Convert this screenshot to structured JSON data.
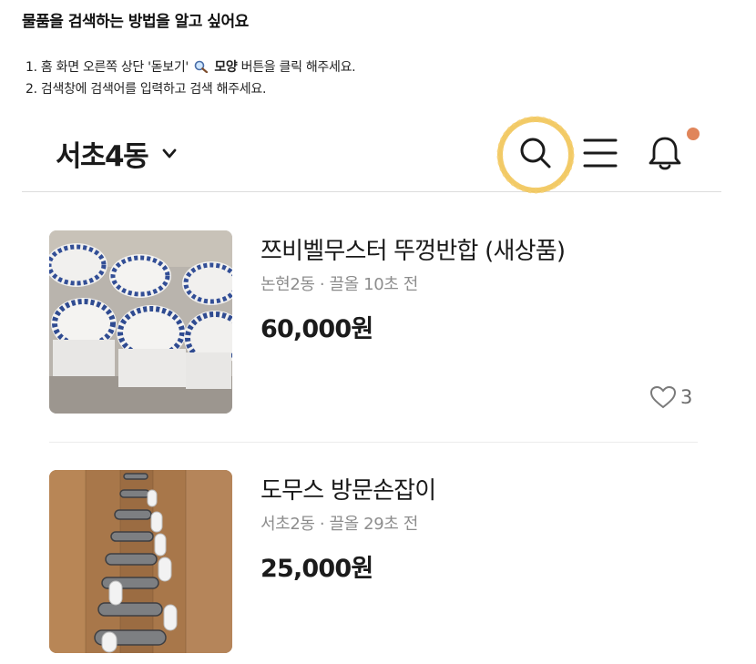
{
  "guide": {
    "title": "물품을 검색하는 방법을 알고 싶어요",
    "step1_pre": "1. 홈 화면 오른쪽 상단 '돋보기'",
    "step1_bold": "모양",
    "step1_post": " 버튼을 클릭 해주세요.",
    "step2": "2. 검색창에 검색어를 입력하고 검색 해주세요."
  },
  "header": {
    "location": "서초4동",
    "icons": [
      "search-icon",
      "menu-icon",
      "bell-icon"
    ],
    "notif_color": "#e0855a",
    "highlight_color": "#f0c14b"
  },
  "items": [
    {
      "title": "쯔비벨무스터 뚜껑반합 (새상품)",
      "meta": "논현2동 · 끌올 10초 전",
      "price": "60,000원",
      "likes": "3"
    },
    {
      "title": "도무스 방문손잡이",
      "meta": "서초2동 · 끌올 29초 전",
      "price": "25,000원"
    }
  ]
}
